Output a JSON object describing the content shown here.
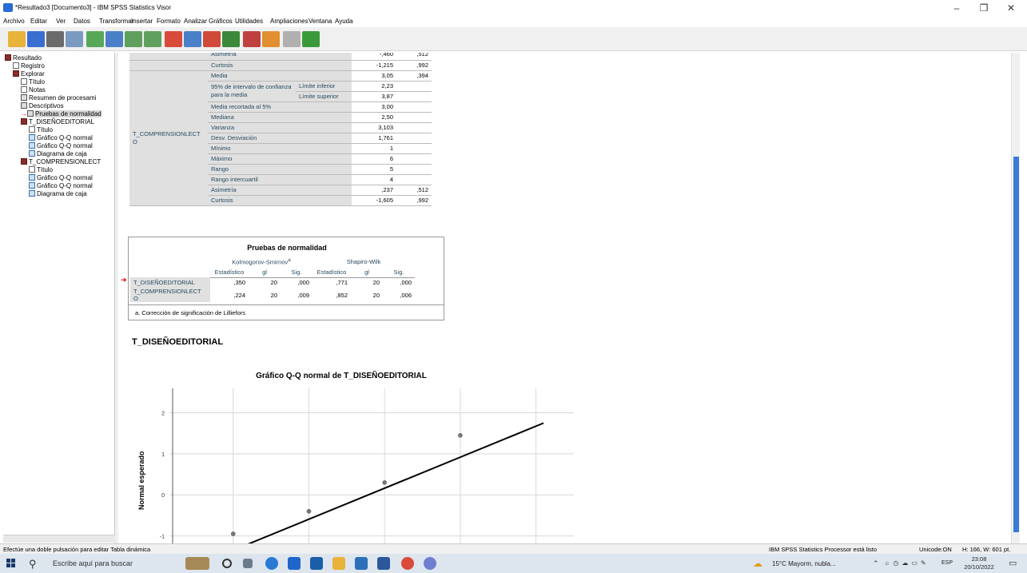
{
  "window": {
    "title": "*Resultado3 [Documento3] - IBM SPSS Statistics Visor",
    "minimize": "–",
    "maximize": "❐",
    "close": "✕"
  },
  "menu": [
    "Archivo",
    "Editar",
    "Ver",
    "Datos",
    "Transformar",
    "Insertar",
    "Formato",
    "Analizar",
    "Gráficos",
    "Utilidades",
    "Ampliaciones",
    "Ventana",
    "Ayuda"
  ],
  "nav": {
    "items": [
      {
        "label": "Resultado",
        "icon": "output-book-icon",
        "indent": 0
      },
      {
        "label": "Registro",
        "icon": "log-icon",
        "indent": 1
      },
      {
        "label": "Explorar",
        "icon": "explore-book-icon",
        "indent": 1
      },
      {
        "label": "Título",
        "icon": "title-icon",
        "indent": 2
      },
      {
        "label": "Notas",
        "icon": "notes-icon",
        "indent": 2
      },
      {
        "label": "Resumen de procesami",
        "icon": "table-icon",
        "indent": 2
      },
      {
        "label": "Descriptivos",
        "icon": "table-icon",
        "indent": 2
      },
      {
        "label": "Pruebas de normalidad",
        "icon": "table-icon",
        "indent": 2,
        "selected": true
      },
      {
        "label": "T_DISEÑOEDITORIAL",
        "icon": "book-icon",
        "indent": 2
      },
      {
        "label": "Título",
        "icon": "title-icon",
        "indent": 3
      },
      {
        "label": "Gráfico Q-Q normal",
        "icon": "chart-icon",
        "indent": 3
      },
      {
        "label": "Gráfico Q-Q normal",
        "icon": "chart-icon",
        "indent": 3
      },
      {
        "label": "Diagrama de caja",
        "icon": "chart-icon",
        "indent": 3
      },
      {
        "label": "T_COMPRENSIONLECT",
        "icon": "book-icon",
        "indent": 2
      },
      {
        "label": "Título",
        "icon": "title-icon",
        "indent": 3
      },
      {
        "label": "Gráfico Q-Q normal",
        "icon": "chart-icon",
        "indent": 3
      },
      {
        "label": "Gráfico Q-Q normal",
        "icon": "chart-icon",
        "indent": 3
      },
      {
        "label": "Diagrama de caja",
        "icon": "chart-icon",
        "indent": 3
      }
    ]
  },
  "descriptives": {
    "top_rows": [
      {
        "label": "Asimetría",
        "stat": "-,460",
        "err": ",512"
      },
      {
        "label": "Curtosis",
        "stat": "-1,215",
        "err": ",992"
      }
    ],
    "variable": "T_COMPRENSIONLECT\nO",
    "rows": [
      {
        "label": "Media",
        "sub": "",
        "stat": "3,05",
        "err": ",394"
      },
      {
        "label": "95% de intervalo de confianza para la media",
        "sub": "Límite inferior",
        "stat": "2,23",
        "err": ""
      },
      {
        "label": "",
        "sub": "Límite superior",
        "stat": "3,87",
        "err": ""
      },
      {
        "label": "Media recortada al 5%",
        "sub": "",
        "stat": "3,00",
        "err": ""
      },
      {
        "label": "Mediana",
        "sub": "",
        "stat": "2,50",
        "err": ""
      },
      {
        "label": "Varianza",
        "sub": "",
        "stat": "3,103",
        "err": ""
      },
      {
        "label": "Desv. Desviación",
        "sub": "",
        "stat": "1,761",
        "err": ""
      },
      {
        "label": "Mínimo",
        "sub": "",
        "stat": "1",
        "err": ""
      },
      {
        "label": "Máximo",
        "sub": "",
        "stat": "6",
        "err": ""
      },
      {
        "label": "Rango",
        "sub": "",
        "stat": "5",
        "err": ""
      },
      {
        "label": "Rango intercuartil",
        "sub": "",
        "stat": "4",
        "err": ""
      },
      {
        "label": "Asimetría",
        "sub": "",
        "stat": ",237",
        "err": ",512"
      },
      {
        "label": "Curtosis",
        "sub": "",
        "stat": "-1,605",
        "err": ",992"
      }
    ]
  },
  "normality": {
    "title": "Pruebas de normalidad",
    "group1": "Kolmogorov-Smirnov",
    "group1_sup": "a",
    "group2": "Shapiro-Wilk",
    "cols": [
      "Estadístico",
      "gl",
      "Sig.",
      "Estadístico",
      "gl",
      "Sig."
    ],
    "rows": [
      {
        "name": "T_DISEÑOEDITORIAL",
        "v": [
          ",350",
          "20",
          ",000",
          ",771",
          "20",
          ",000"
        ]
      },
      {
        "name": "T_COMPRENSIONLECT\nO",
        "v": [
          ",224",
          "20",
          ",009",
          ",852",
          "20",
          ",006"
        ]
      }
    ],
    "footnote": "a. Corrección de significación de Lilliefors"
  },
  "section_title": "T_DISEÑOEDITORIAL",
  "chart_data": {
    "type": "scatter",
    "title": "Gráfico Q-Q normal de T_DISEÑOEDITORIAL",
    "xlabel": "",
    "ylabel": "Normal esperado",
    "yticks": [
      2,
      1,
      0,
      -1
    ],
    "points": [
      {
        "x": 1,
        "y": -0.95
      },
      {
        "x": 2,
        "y": -0.4
      },
      {
        "x": 3,
        "y": 0.3
      },
      {
        "x": 4,
        "y": 1.45
      }
    ],
    "line": [
      [
        0.8,
        -1.5
      ],
      [
        5.1,
        1.75
      ]
    ],
    "grid": true
  },
  "status": {
    "left": "Efectúe una doble pulsación para editar Tabla dinámica",
    "processor": "IBM SPSS Statistics Processor está listo",
    "unicode": "Unicode:ON",
    "dims": "H: 166, W: 601 pt."
  },
  "taskbar": {
    "search": "Escribe aquí para buscar",
    "weather": "15°C  Mayorm. nubla...",
    "lang": "ESP",
    "time": "23:08",
    "date": "20/10/2022"
  }
}
